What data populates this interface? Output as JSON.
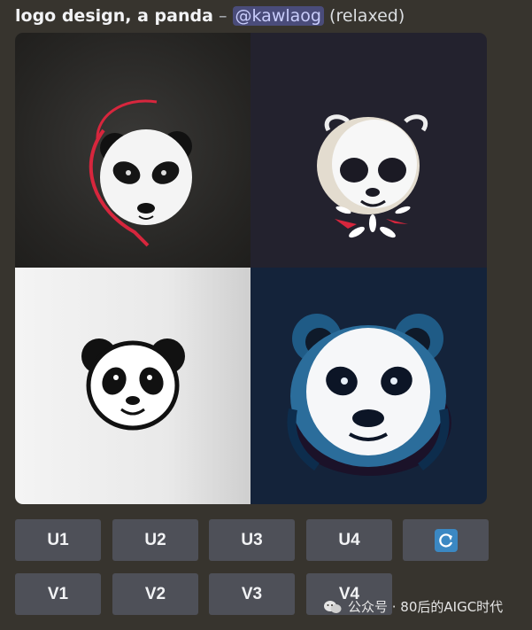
{
  "message": {
    "prompt": "logo design, a panda",
    "separator": " – ",
    "mention": "@kawlaog",
    "mode": "(relaxed)"
  },
  "image_grid": {
    "cells": [
      {
        "description": "panda logo on dark gray",
        "palette": [
          "#262523",
          "#ffffff",
          "#d7263d"
        ]
      },
      {
        "description": "panda logo on navy with leaves",
        "palette": [
          "#23222e",
          "#ffffff",
          "#e3dccf",
          "#d7263d"
        ]
      },
      {
        "description": "panda logo on light gray",
        "palette": [
          "#eeeeee",
          "#111111"
        ]
      },
      {
        "description": "panda logo on dark blue",
        "palette": [
          "#14233a",
          "#1f5b86",
          "#ffffff",
          "#1b1229"
        ]
      }
    ]
  },
  "buttons": {
    "upscale": [
      "U1",
      "U2",
      "U3",
      "U4"
    ],
    "variation": [
      "V1",
      "V2",
      "V3",
      "V4"
    ],
    "reroll_icon": "refresh-icon"
  },
  "watermark": {
    "text": "公众号 · 80后的AIGC时代",
    "icon": "wechat-icon"
  },
  "colors": {
    "background": "#37342e",
    "button": "#4e5058",
    "mention_bg": "#4a4c7a",
    "mention_fg": "#c9cdfb",
    "reroll": "#3b88c3"
  }
}
